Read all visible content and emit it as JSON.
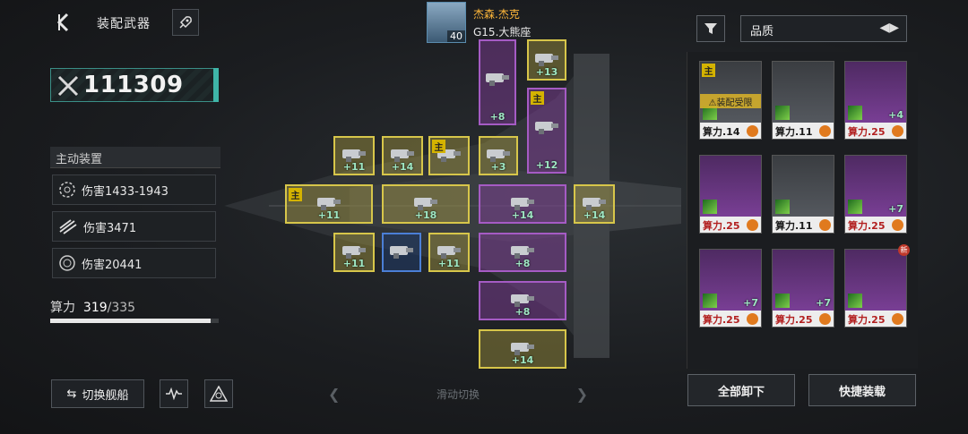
{
  "header": {
    "title": "装配武器",
    "back_icon": "back-arrow-icon",
    "rocket_icon": "rocket-icon"
  },
  "power": {
    "value": "111309",
    "icon": "crossed-swords-icon"
  },
  "active_device": {
    "title": "主动装置",
    "stats": [
      {
        "icon": "target-ring-icon",
        "label": "伤害1433-1943"
      },
      {
        "icon": "slash-claw-icon",
        "label": "伤害3471"
      },
      {
        "icon": "burst-circle-icon",
        "label": "伤害20441"
      }
    ]
  },
  "compute": {
    "label": "算力",
    "current": "319",
    "separator": "/",
    "max": "335",
    "fraction": 0.952
  },
  "bottom_bar": {
    "switch_ship": "切换舰船",
    "swipe_hint": "滑动切换"
  },
  "pilot": {
    "name": "杰森.杰克",
    "level": "40",
    "ship": "G15.大熊座"
  },
  "slots": [
    {
      "id": "s1",
      "color": "p",
      "level": "+8",
      "main": false
    },
    {
      "id": "s2",
      "color": "y",
      "level": "+13",
      "main": false
    },
    {
      "id": "s3",
      "color": "p",
      "level": "+12",
      "main": true
    },
    {
      "id": "s4",
      "color": "y",
      "level": "+11",
      "main": false
    },
    {
      "id": "s5",
      "color": "y",
      "level": "+14",
      "main": false
    },
    {
      "id": "s6",
      "color": "y",
      "level": "",
      "main": true
    },
    {
      "id": "s7",
      "color": "y",
      "level": "+3",
      "main": false
    },
    {
      "id": "s8",
      "color": "y",
      "level": "+11",
      "main": true
    },
    {
      "id": "s9",
      "color": "y",
      "level": "+18",
      "main": false
    },
    {
      "id": "s10",
      "color": "p",
      "level": "+14",
      "main": false
    },
    {
      "id": "s11",
      "color": "y",
      "level": "+14",
      "main": false
    },
    {
      "id": "s12",
      "color": "y",
      "level": "+11",
      "main": false
    },
    {
      "id": "s13",
      "color": "b",
      "level": "",
      "main": false
    },
    {
      "id": "s14",
      "color": "y",
      "level": "+11",
      "main": false
    },
    {
      "id": "s15",
      "color": "p",
      "level": "+8",
      "main": false
    },
    {
      "id": "s16",
      "color": "p",
      "level": "+8",
      "main": false
    },
    {
      "id": "s17",
      "color": "y",
      "level": "+14",
      "main": false
    }
  ],
  "inventory": {
    "sort_label": "品质",
    "cards": [
      {
        "cost": "算力.14",
        "level": "",
        "tier": "gray",
        "main": true,
        "limit": "装配受限",
        "new": false
      },
      {
        "cost": "算力.11",
        "level": "",
        "tier": "gray",
        "main": false,
        "limit": "",
        "new": false
      },
      {
        "cost": "算力.25",
        "level": "+4",
        "tier": "purple",
        "main": false,
        "limit": "",
        "new": false
      },
      {
        "cost": "算力.25",
        "level": "",
        "tier": "purple",
        "main": false,
        "limit": "",
        "new": false
      },
      {
        "cost": "算力.11",
        "level": "",
        "tier": "gray",
        "main": false,
        "limit": "",
        "new": false
      },
      {
        "cost": "算力.25",
        "level": "+7",
        "tier": "purple",
        "main": false,
        "limit": "",
        "new": false
      },
      {
        "cost": "算力.25",
        "level": "+7",
        "tier": "purple",
        "main": false,
        "limit": "",
        "new": false
      },
      {
        "cost": "算力.25",
        "level": "+7",
        "tier": "purple",
        "main": false,
        "limit": "",
        "new": false
      },
      {
        "cost": "算力.25",
        "level": "",
        "tier": "purple",
        "main": false,
        "limit": "",
        "new": true
      }
    ],
    "unload_all": "全部卸下",
    "quick_equip": "快捷装载",
    "main_tag": "主",
    "new_tag": "新"
  }
}
